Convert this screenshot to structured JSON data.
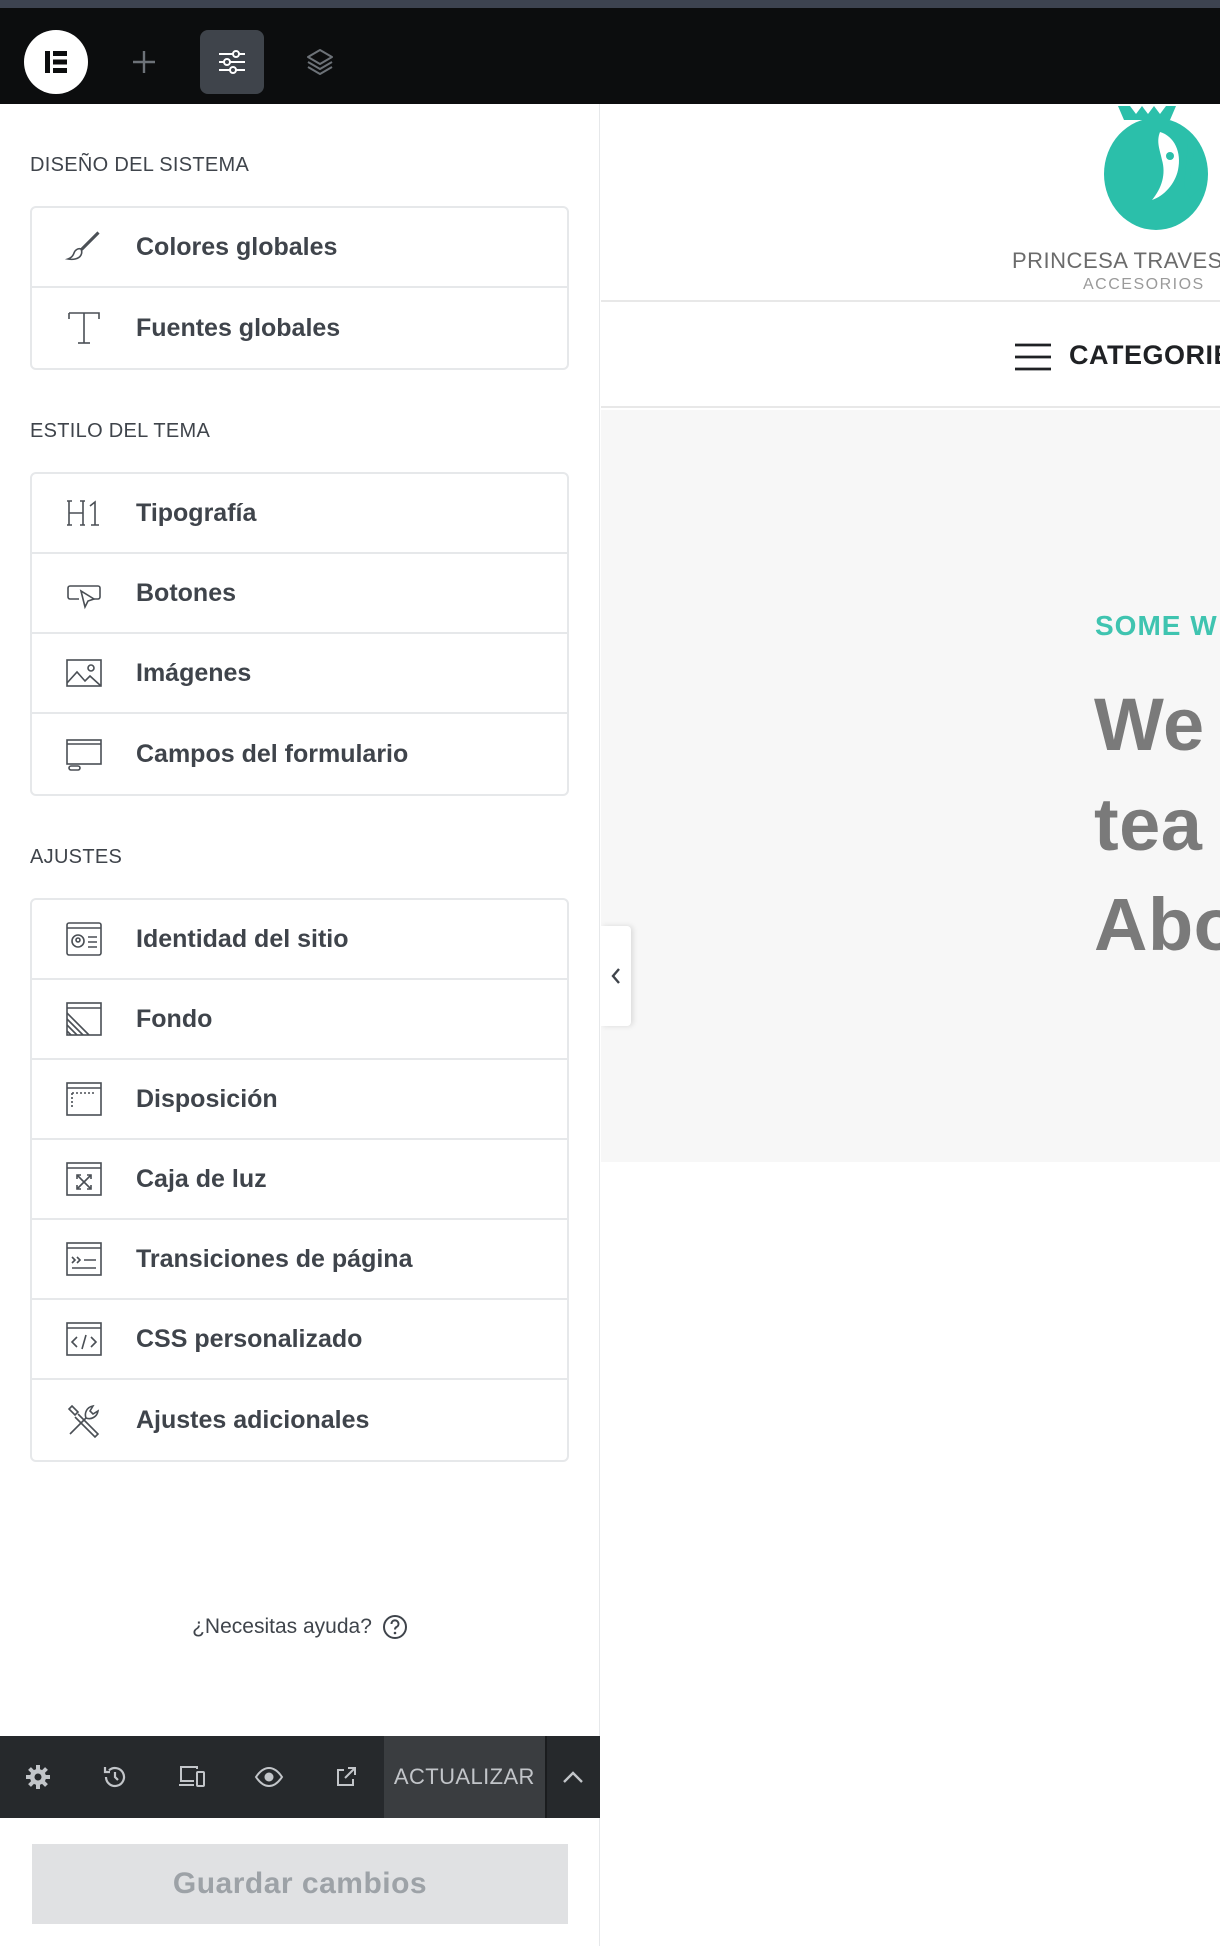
{
  "sidebar": {
    "sections": [
      {
        "title": "DISEÑO DEL SISTEMA",
        "items": [
          {
            "label": "Colores globales",
            "icon": "brush-icon"
          },
          {
            "label": "Fuentes globales",
            "icon": "text-font-icon"
          }
        ]
      },
      {
        "title": "ESTILO DEL TEMA",
        "items": [
          {
            "label": "Tipografía",
            "icon": "h1-icon"
          },
          {
            "label": "Botones",
            "icon": "button-cursor-icon"
          },
          {
            "label": "Imágenes",
            "icon": "image-icon"
          },
          {
            "label": "Campos del formulario",
            "icon": "form-field-icon"
          }
        ]
      },
      {
        "title": "AJUSTES",
        "items": [
          {
            "label": "Identidad del sitio",
            "icon": "site-identity-icon"
          },
          {
            "label": "Fondo",
            "icon": "background-icon"
          },
          {
            "label": "Disposición",
            "icon": "layout-icon"
          },
          {
            "label": "Caja de luz",
            "icon": "lightbox-icon"
          },
          {
            "label": "Transiciones de página",
            "icon": "page-transitions-icon"
          },
          {
            "label": "CSS personalizado",
            "icon": "custom-css-icon"
          },
          {
            "label": "Ajustes adicionales",
            "icon": "tools-icon"
          }
        ]
      }
    ],
    "help_label": "¿Necesitas ayuda?"
  },
  "footer": {
    "update_label": "ACTUALIZAR",
    "save_label": "Guardar cambios"
  },
  "preview": {
    "brand_name": "PRINCESA TRAVES",
    "brand_sub": "ACCESORIOS",
    "nav_label": "CATEGORIE",
    "hero_kicker": "SOME W",
    "hero_lines": [
      "We",
      "tea",
      "Abo"
    ],
    "accent_color": "#3fc4b0"
  }
}
